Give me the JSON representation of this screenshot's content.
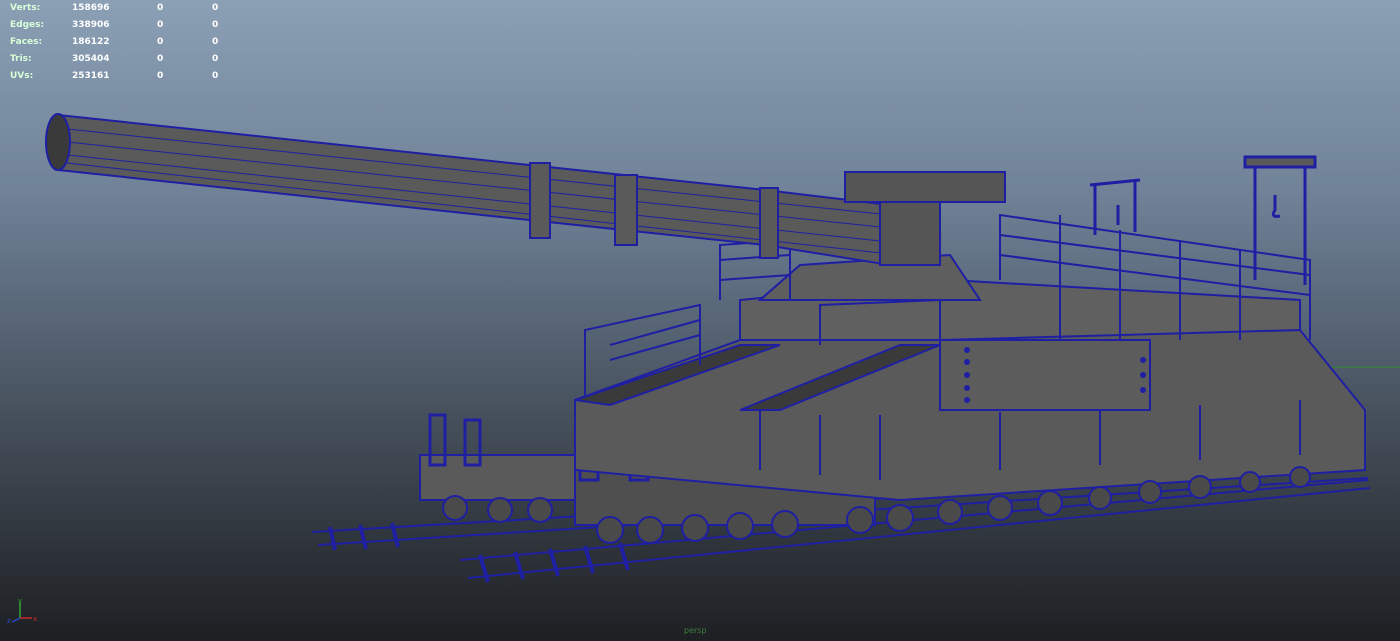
{
  "hud": {
    "rows": [
      {
        "label": "Verts:",
        "values": [
          "158696",
          "0",
          "0"
        ]
      },
      {
        "label": "Edges:",
        "values": [
          "338906",
          "0",
          "0"
        ]
      },
      {
        "label": "Faces:",
        "values": [
          "186122",
          "0",
          "0"
        ]
      },
      {
        "label": "Tris:",
        "values": [
          "305404",
          "0",
          "0"
        ]
      },
      {
        "label": "UVs:",
        "values": [
          "253161",
          "0",
          "0"
        ]
      }
    ]
  },
  "viewport": {
    "camera": "persp",
    "axis_labels": {
      "x": "x",
      "y": "y",
      "z": "z"
    }
  },
  "colors": {
    "wire": "#1f1fa3",
    "shaded": "#5a5a5a",
    "shaded_dark": "#414141",
    "grid_x": "#2e8b2e"
  }
}
